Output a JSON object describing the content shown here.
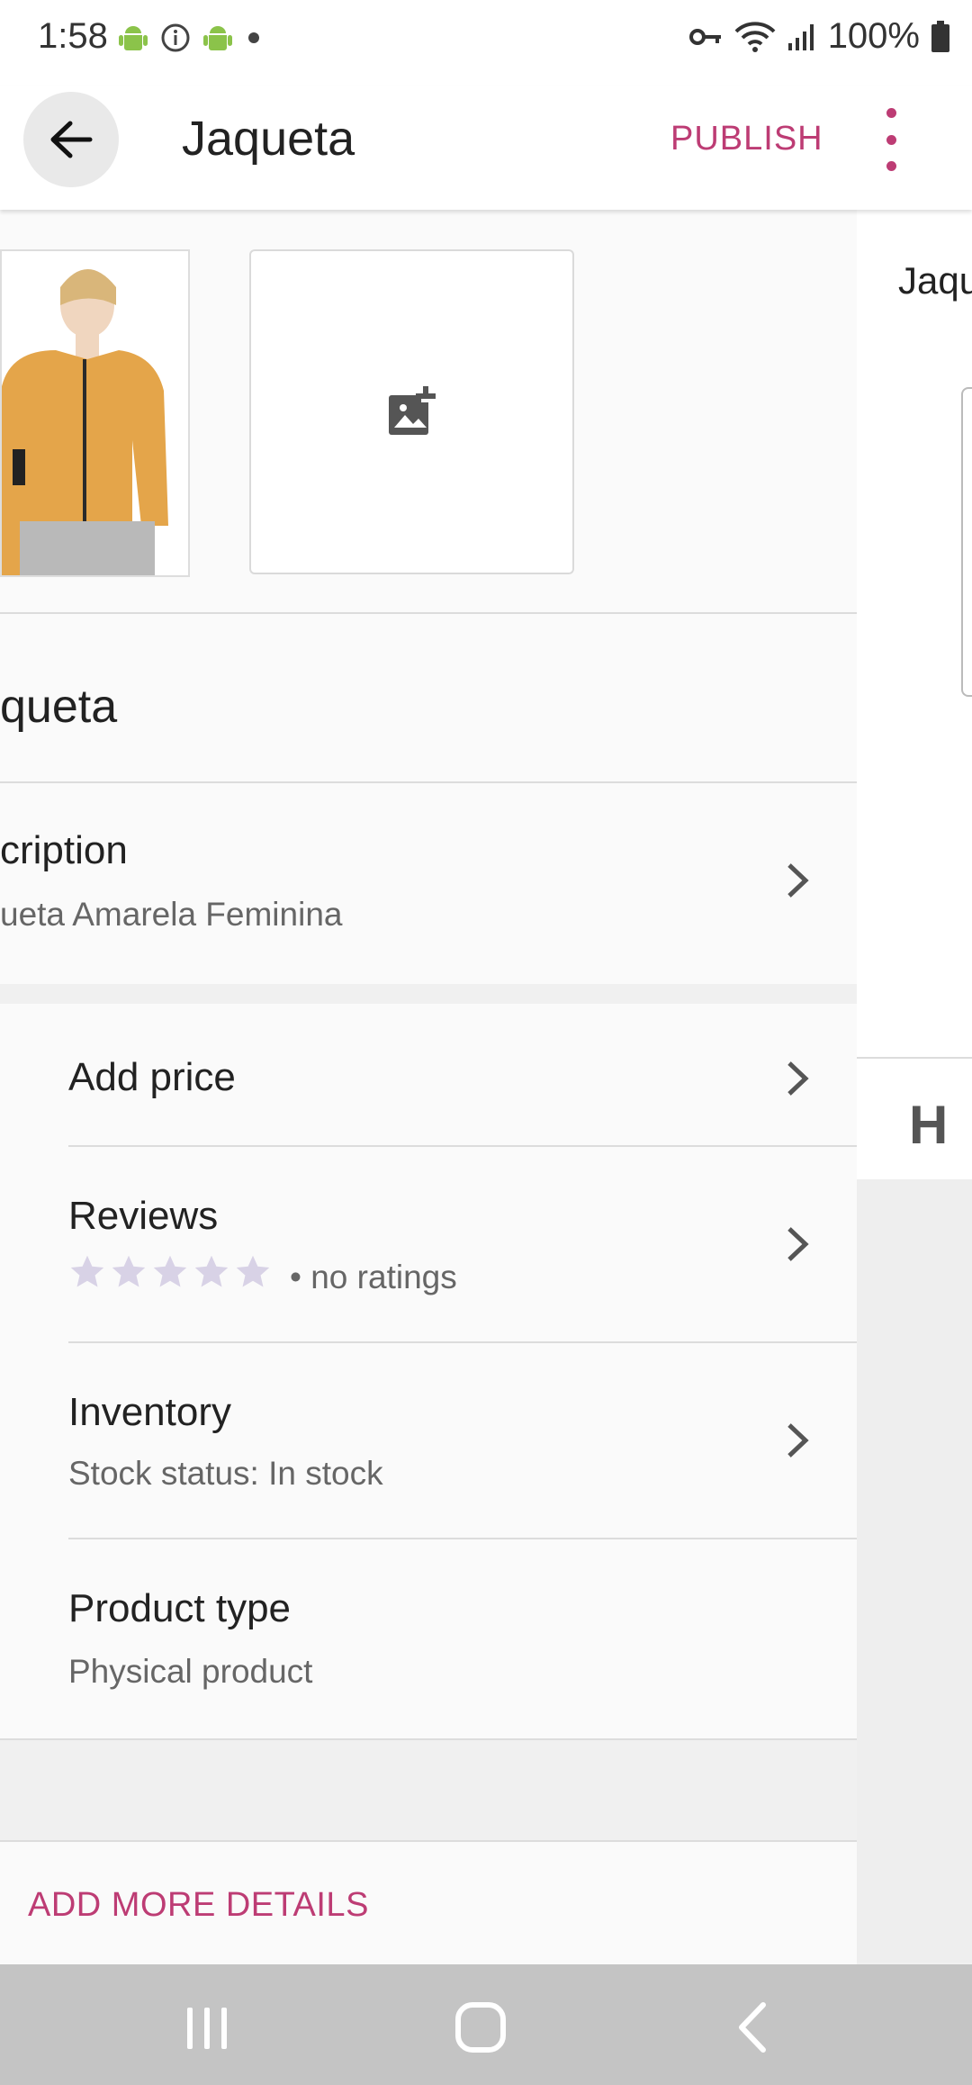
{
  "status_bar": {
    "time": "1:58",
    "battery": "100%"
  },
  "app_bar": {
    "title": "Jaqueta",
    "publish_label": "PUBLISH"
  },
  "product": {
    "name_partial": "queta",
    "description_title_partial": "cription",
    "description_value_partial": "ueta Amarela Feminina"
  },
  "details": {
    "price_label": "Add price",
    "reviews_label": "Reviews",
    "reviews_rating_text": "• no ratings",
    "inventory_label": "Inventory",
    "inventory_status": "Stock status: In stock",
    "product_type_label": "Product type",
    "product_type_value": "Physical product"
  },
  "actions": {
    "add_more_details": "ADD MORE DETAILS"
  },
  "side_panel": {
    "title_partial": "Jaqu",
    "letter": "H"
  },
  "colors": {
    "accent": "#bd3c74",
    "star_empty": "#d8d2e6",
    "app_icon_green": "#8bc34a"
  },
  "icons": {
    "back": "arrow-left-icon",
    "more": "more-vert-icon",
    "add_image": "add-photo-icon",
    "chevron": "chevron-right-icon"
  }
}
